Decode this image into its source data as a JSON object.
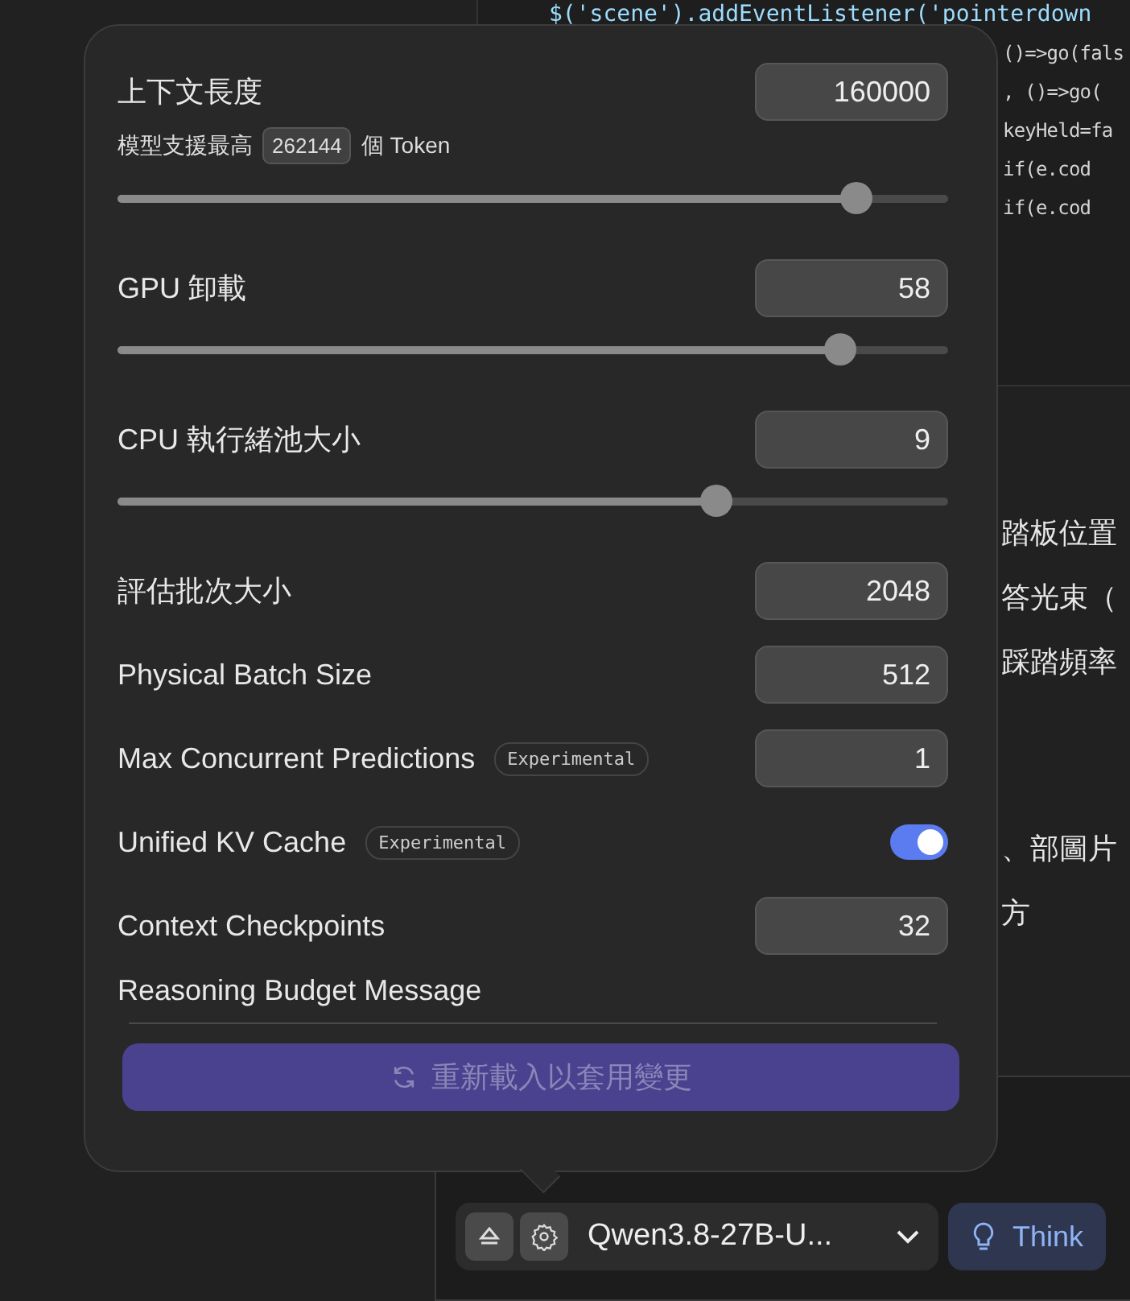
{
  "editor": {
    "lines": [
      "$('scene').addEventListener('pointerdown",
      "()=>go(fals",
      ", ()=>go(",
      "keyHeld=fa",
      "if(e.cod",
      "if(e.cod"
    ]
  },
  "chat": {
    "lines": [
      "踏板位置",
      "答光束（",
      "踩踏頻率",
      "、部圖片",
      "方"
    ]
  },
  "settings": {
    "rows": [
      {
        "kind": "slider",
        "label": "上下文長度",
        "value": "160000",
        "note": {
          "before": "模型支援最高",
          "chip": "262144",
          "after": "個 Token"
        },
        "level": 0.89
      },
      {
        "kind": "slider",
        "label": "GPU 卸載",
        "value": "58",
        "level": 0.87
      },
      {
        "kind": "slider",
        "label": "CPU 執行緒池大小",
        "value": "9",
        "level": 0.72
      },
      {
        "kind": "number",
        "label": "評估批次大小",
        "value": "2048"
      },
      {
        "kind": "number",
        "label": "Physical Batch Size",
        "value": "512"
      },
      {
        "kind": "number",
        "label": "Max Concurrent Predictions",
        "badge": "Experimental",
        "value": "1"
      },
      {
        "kind": "toggle",
        "label": "Unified KV Cache",
        "badge": "Experimental",
        "on": true
      },
      {
        "kind": "number",
        "label": "Context Checkpoints",
        "value": "32"
      },
      {
        "kind": "heading",
        "label": "Reasoning Budget Message"
      }
    ],
    "reload_button": "重新載入以套用變更"
  },
  "composer": {
    "model": "Qwen3.8-27B-U...",
    "think_button": {
      "label": "Think",
      "selected": true
    }
  }
}
